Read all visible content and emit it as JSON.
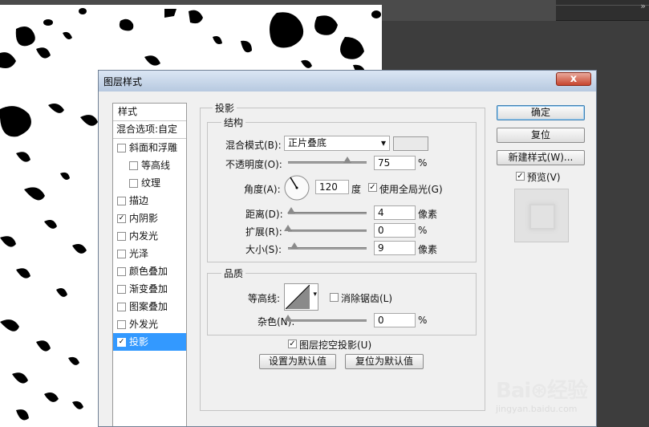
{
  "dialog": {
    "title": "图层样式",
    "close_label": "x"
  },
  "style_list": {
    "header": "样式",
    "blend_options": "混合选项:自定",
    "items": [
      {
        "label": "斜面和浮雕",
        "checked": false,
        "indent": false
      },
      {
        "label": "等高线",
        "checked": false,
        "indent": true
      },
      {
        "label": "纹理",
        "checked": false,
        "indent": true
      },
      {
        "label": "描边",
        "checked": false,
        "indent": false
      },
      {
        "label": "内阴影",
        "checked": true,
        "indent": false
      },
      {
        "label": "内发光",
        "checked": false,
        "indent": false
      },
      {
        "label": "光泽",
        "checked": false,
        "indent": false
      },
      {
        "label": "颜色叠加",
        "checked": false,
        "indent": false
      },
      {
        "label": "渐变叠加",
        "checked": false,
        "indent": false
      },
      {
        "label": "图案叠加",
        "checked": false,
        "indent": false
      },
      {
        "label": "外发光",
        "checked": false,
        "indent": false
      },
      {
        "label": "投影",
        "checked": true,
        "indent": false,
        "selected": true
      }
    ]
  },
  "drop_shadow": {
    "section_title": "投影",
    "structure_title": "结构",
    "blend_mode_label": "混合模式(B):",
    "blend_mode_value": "正片叠底",
    "blend_mode_arrow": "▾",
    "opacity_label": "不透明度(O):",
    "opacity_value": "75",
    "opacity_unit": "%",
    "opacity_level": 0.75,
    "angle_label": "角度(A):",
    "angle_value": "120",
    "angle_unit": "度",
    "global_light_label": "使用全局光(G)",
    "global_light_checked": true,
    "distance_label": "距离(D):",
    "distance_value": "4",
    "distance_unit": "像素",
    "spread_label": "扩展(R):",
    "spread_value": "0",
    "spread_unit": "%",
    "size_label": "大小(S):",
    "size_value": "9",
    "size_unit": "像素",
    "quality_title": "品质",
    "contour_label": "等高线:",
    "anti_alias_label": "消除锯齿(L)",
    "anti_alias_checked": false,
    "noise_label": "杂色(N):",
    "noise_value": "0",
    "noise_unit": "%",
    "knockout_label": "图层挖空投影(U)",
    "knockout_checked": true,
    "make_default_label": "设置为默认值",
    "reset_default_label": "复位为默认值"
  },
  "buttons": {
    "ok": "确定",
    "reset": "复位",
    "new_style": "新建样式(W)...",
    "preview_label": "预览(V)",
    "preview_checked": true
  },
  "watermark": {
    "logo": "Bai⊛经验",
    "url": "jingyan.baidu.com"
  },
  "colors": {
    "selection": "#3399ff",
    "titlebar": "#c9d8ec",
    "close_button": "#c7452e"
  },
  "icons": {
    "panel_grip": "double-arrow-icon",
    "check": "✓"
  }
}
